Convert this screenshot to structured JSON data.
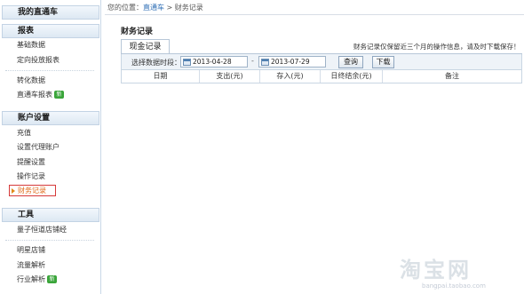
{
  "sidebar": {
    "title": "我的直通车",
    "sections": [
      {
        "header": "报表",
        "items": [
          "基础数据",
          "定向投放报表"
        ]
      },
      {
        "items": [
          "转化数据",
          "直通车报表"
        ]
      },
      {
        "header": "账户设置",
        "items": [
          "充值",
          "设置代理账户",
          "提醒设置",
          "操作记录",
          "财务记录"
        ]
      },
      {
        "header": "工具",
        "items": [
          "量子恒道店铺经"
        ]
      },
      {
        "items": [
          "明星店铺",
          "流量解析",
          "行业解析"
        ]
      }
    ],
    "badge_new": "新"
  },
  "breadcrumb": {
    "prefix": "您的位置：",
    "link": "直通车",
    "sep": " > ",
    "current": "财务记录"
  },
  "main": {
    "title": "财务记录",
    "tab": "现金记录",
    "notice": "财务记录仅保留近三个月的操作信息，请及时下载保存！",
    "filter": {
      "label": "选择数据时段：",
      "start_date": "2013-04-28",
      "dash": "-",
      "end_date": "2013-07-29",
      "query_label": "查询",
      "download_label": "下载"
    },
    "table": {
      "columns": [
        "日期",
        "支出(元)",
        "存入(元)",
        "日终结余(元)",
        "备注"
      ],
      "rows": []
    }
  },
  "watermark": {
    "main": "淘宝网",
    "sub": "bangpai.taobao.com"
  },
  "colors": {
    "accent": "#2e6eb5",
    "active": "#e06a1a",
    "active_border": "#d63a3a",
    "badge": "#3aa53a"
  }
}
